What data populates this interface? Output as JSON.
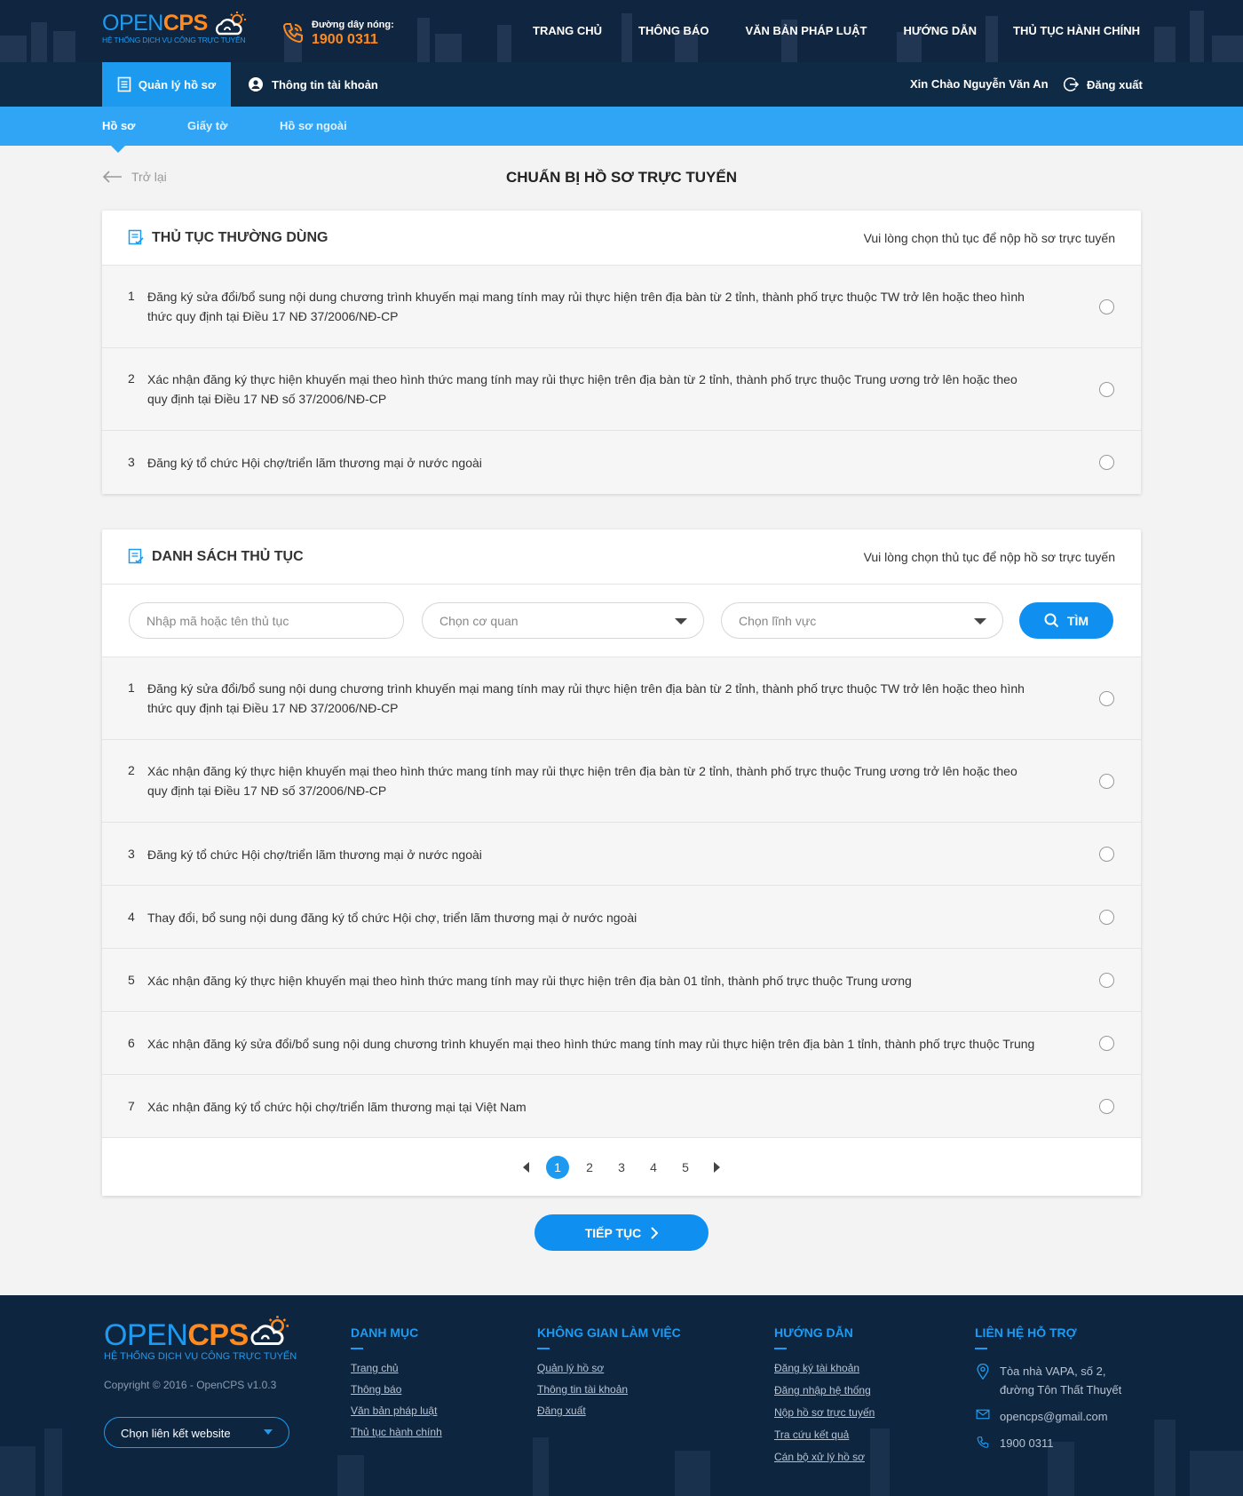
{
  "header": {
    "logo": {
      "open": "OPEN",
      "cps": "CPS",
      "tagline": "HỆ THỐNG DỊCH VỤ CÔNG TRỰC TUYẾN"
    },
    "hotline": {
      "label": "Đường dây nóng:",
      "number": "1900 0311"
    },
    "nav": [
      "TRANG CHỦ",
      "THÔNG BÁO",
      "VĂN BẢN PHÁP LUẬT",
      "HƯỚNG DẪN",
      "THỦ TỤC HÀNH CHÍNH"
    ]
  },
  "userbar": {
    "tab_active": "Quản lý hồ sơ",
    "tab_account": "Thông tin tài khoản",
    "greeting": "Xin Chào Nguyễn Văn An",
    "logout": "Đăng xuất"
  },
  "subnav": {
    "items": [
      "Hồ sơ",
      "Giấy tờ",
      "Hồ sơ ngoài"
    ],
    "active": "Hồ sơ"
  },
  "page": {
    "back": "Trở lại",
    "title": "CHUẨN BỊ HỒ SƠ TRỰC TUYẾN"
  },
  "common": {
    "title": "THỦ TỤC THƯỜNG DÙNG",
    "hint": "Vui lòng chọn thủ tục để nộp hồ sơ trực tuyến",
    "items": [
      {
        "no": "1",
        "text": "Đăng ký sửa đổi/bổ sung nội dung chương trình khuyến mại mang tính may rủi thực hiện trên địa bàn từ 2 tỉnh, thành phố trực thuộc TW trở lên hoặc theo hình thức quy định tại Điều 17 NĐ 37/2006/NĐ-CP"
      },
      {
        "no": "2",
        "text": "Xác nhận đăng ký thực hiện khuyến mại theo hình thức mang tính may rủi thực hiện trên địa bàn từ 2 tỉnh, thành phố trực thuộc Trung ương trở lên hoặc theo quy định tại Điều 17 NĐ số 37/2006/NĐ-CP"
      },
      {
        "no": "3",
        "text": "Đăng ký tổ chức Hội chợ/triển lãm thương mại ở nước ngoài"
      }
    ]
  },
  "procedures": {
    "title": "DANH SÁCH THỦ TỤC",
    "hint": "Vui lòng chọn thủ tục để nộp hồ sơ trực tuyến",
    "search_placeholder": "Nhập mã hoặc tên thủ tục",
    "agency_placeholder": "Chọn cơ quan",
    "field_placeholder": "Chọn lĩnh vực",
    "search_button": "TÌM",
    "items": [
      {
        "no": "1",
        "text": "Đăng ký sửa đổi/bổ sung nội dung chương trình khuyến mại mang tính may rủi thực hiện trên địa bàn từ 2 tỉnh, thành phố trực thuộc TW trở lên hoặc theo hình thức quy định tại Điều 17 NĐ 37/2006/NĐ-CP"
      },
      {
        "no": "2",
        "text": "Xác nhận đăng ký thực hiện khuyến mại theo hình thức mang tính may rủi thực hiện trên địa bàn từ 2 tỉnh, thành phố trực thuộc Trung ương trở lên hoặc theo quy định tại Điều 17 NĐ số 37/2006/NĐ-CP"
      },
      {
        "no": "3",
        "text": "Đăng ký tổ chức Hội chợ/triển lãm thương mại ở nước ngoài"
      },
      {
        "no": "4",
        "text": "Thay đổi, bổ sung nội dung đăng ký tổ chức Hội chợ, triển lãm thương mại ở nước ngoài"
      },
      {
        "no": "5",
        "text": "Xác nhận đăng ký thực hiện khuyến mại theo hình thức mang tính may rủi thực hiện trên địa bàn 01 tỉnh, thành phố trực thuộc Trung ương"
      },
      {
        "no": "6",
        "text": "Xác nhận đăng ký sửa đổi/bổ sung nội dung chương trình khuyến mại theo hình thức mang tính may rủi thực hiện trên địa bàn 1 tỉnh, thành phố trực thuộc Trung"
      },
      {
        "no": "7",
        "text": "Xác nhận đăng ký tổ chức hội chợ/triển lãm thương mại tại Việt Nam"
      }
    ],
    "pages": [
      "1",
      "2",
      "3",
      "4",
      "5"
    ],
    "current_page": "1"
  },
  "continue_button": "TIẾP TỤC",
  "footer": {
    "logo": {
      "open": "OPEN",
      "cps": "CPS",
      "tagline": "HỆ THỐNG DỊCH VỤ CÔNG TRỰC TUYẾN"
    },
    "copyright": "Copyright © 2016 - OpenCPS v1.0.3",
    "site_select": "Chọn liên kết website",
    "categories": {
      "title": "DANH MỤC",
      "links": [
        "Trang chủ",
        "Thông báo",
        "Văn bản pháp luật",
        "Thủ tục hành chính"
      ]
    },
    "workspace": {
      "title": "KHÔNG GIAN LÀM VIỆC",
      "links": [
        "Quản lý hồ sơ",
        "Thông tin tài khoản",
        "Đăng xuất"
      ]
    },
    "guide": {
      "title": "HƯỚNG DẪN",
      "links": [
        "Đăng ký tài khoản",
        "Đăng nhập hệ thống",
        "Nộp hồ sơ trực tuyến",
        "Tra cứu kết quả",
        "Cán bộ xử lý hồ sơ"
      ]
    },
    "support": {
      "title": "LIÊN HỆ HỖ TRỢ",
      "address_line1": "Tòa nhà VAPA, số 2,",
      "address_line2": "đường Tôn Thất Thuyết",
      "email": "opencps@gmail.com",
      "phone": "1900 0311"
    }
  },
  "colors": {
    "header_bg": "#10253f",
    "accent": "#1b9af0",
    "subnav": "#30a5f5",
    "orange": "#ff8a1e"
  }
}
